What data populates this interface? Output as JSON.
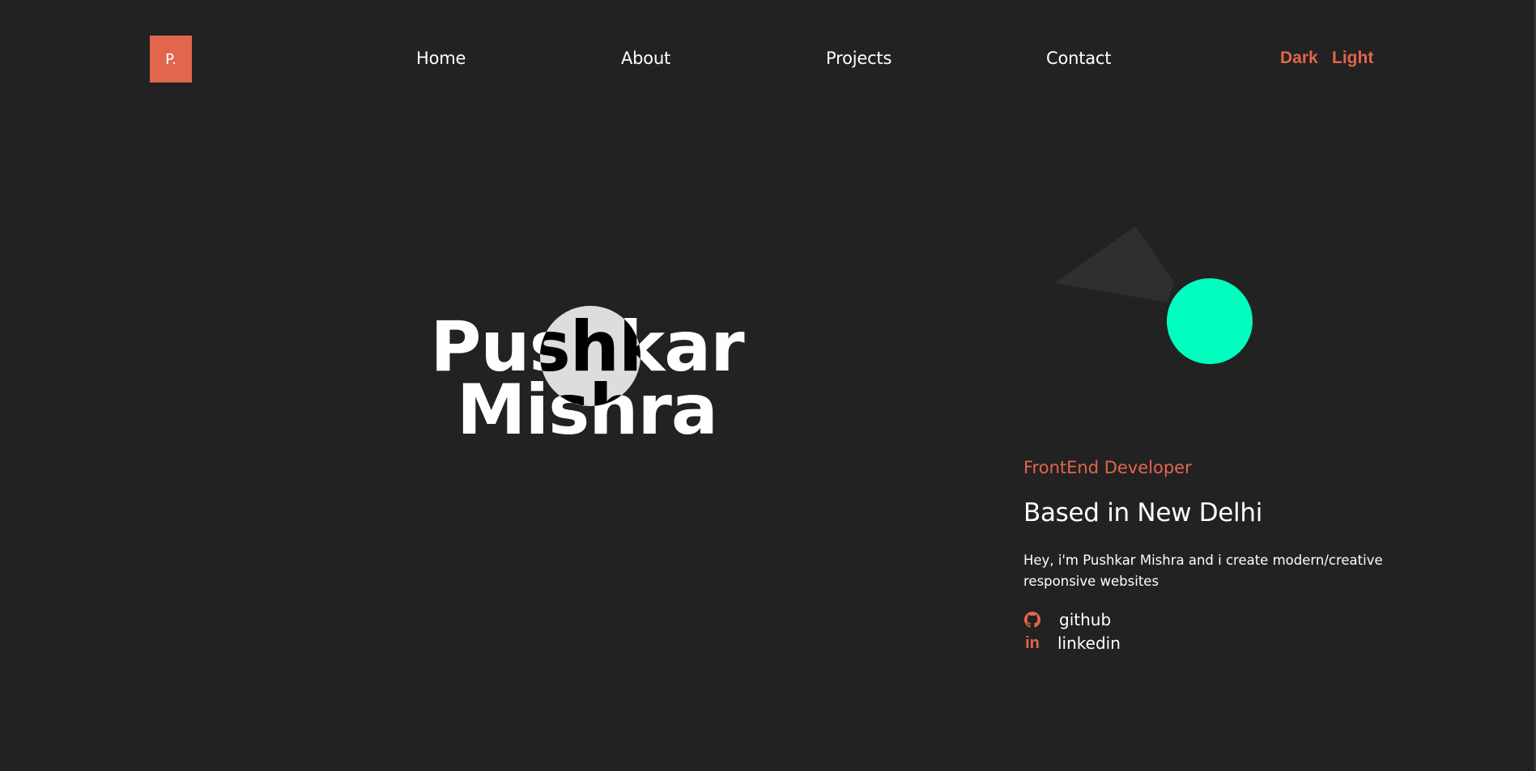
{
  "logo": {
    "text": "P."
  },
  "nav": {
    "items": [
      {
        "label": "Home"
      },
      {
        "label": "About"
      },
      {
        "label": "Projects"
      },
      {
        "label": "Contact"
      }
    ]
  },
  "theme": {
    "dark_label": "Dark",
    "light_label": "Light"
  },
  "hero": {
    "first_name": "Pushkar",
    "last_name": "Mishra"
  },
  "profile": {
    "role": "FrontEnd Developer",
    "location": "Based in New Delhi",
    "bio": "Hey, i'm Pushkar Mishra and i create modern/creative responsive websites",
    "links": [
      {
        "label": "github",
        "icon": "github-icon"
      },
      {
        "label": "linkedin",
        "icon": "linkedin-icon"
      }
    ]
  },
  "colors": {
    "background": "#222222",
    "accent": "#e2664b",
    "mint": "#00ffbf",
    "shape_dark": "#2f2f2f"
  }
}
